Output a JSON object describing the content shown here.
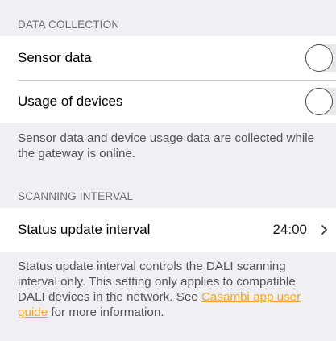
{
  "data_collection": {
    "header": "DATA COLLECTION",
    "rows": [
      {
        "label": "Sensor data",
        "toggle_on": false
      },
      {
        "label": "Usage of devices",
        "toggle_on": false
      }
    ],
    "footer": "Sensor data and device usage data are collected while the gateway is online."
  },
  "scanning_interval": {
    "header": "SCANNING INTERVAL",
    "row": {
      "label": "Status update interval",
      "value": "24:00",
      "chevron": "chevron-right-icon"
    },
    "footer_before_link": "Status update interval controls the DALI scanning interval only. This setting only applies to compatible DALI devices in the network. See ",
    "footer_link": "Casambi app user guide",
    "footer_after_link": " for more information."
  },
  "colors": {
    "background": "#efeff4",
    "link": "#f5a623",
    "section_header": "#6d6d72"
  }
}
